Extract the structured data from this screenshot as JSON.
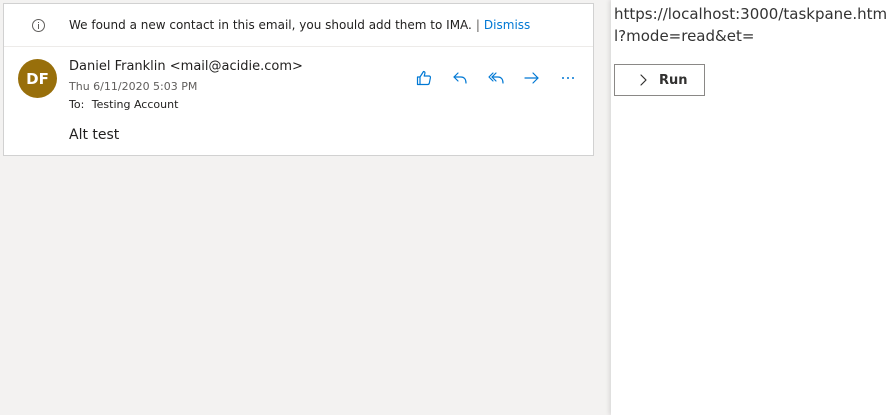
{
  "info_bar": {
    "icon": "info-icon",
    "message": "We found a new contact in this email, you should add them to IMA.",
    "separator": "|",
    "dismiss_label": "Dismiss"
  },
  "email": {
    "avatar_initials": "DF",
    "avatar_color": "#986f0b",
    "sender": "Daniel Franklin <mail@acidie.com>",
    "date": "Thu 6/11/2020 5:03 PM",
    "to_label": "To:",
    "to_value": "Testing Account",
    "body": "Alt test"
  },
  "actions": [
    {
      "name": "like-icon"
    },
    {
      "name": "reply-icon"
    },
    {
      "name": "reply-all-icon"
    },
    {
      "name": "forward-icon"
    },
    {
      "name": "more-icon"
    }
  ],
  "task_pane": {
    "url": "https://localhost:3000/taskpane.html?mode=read&et=",
    "run_label": "Run"
  },
  "colors": {
    "accent": "#0078d4",
    "avatar": "#986f0b"
  }
}
